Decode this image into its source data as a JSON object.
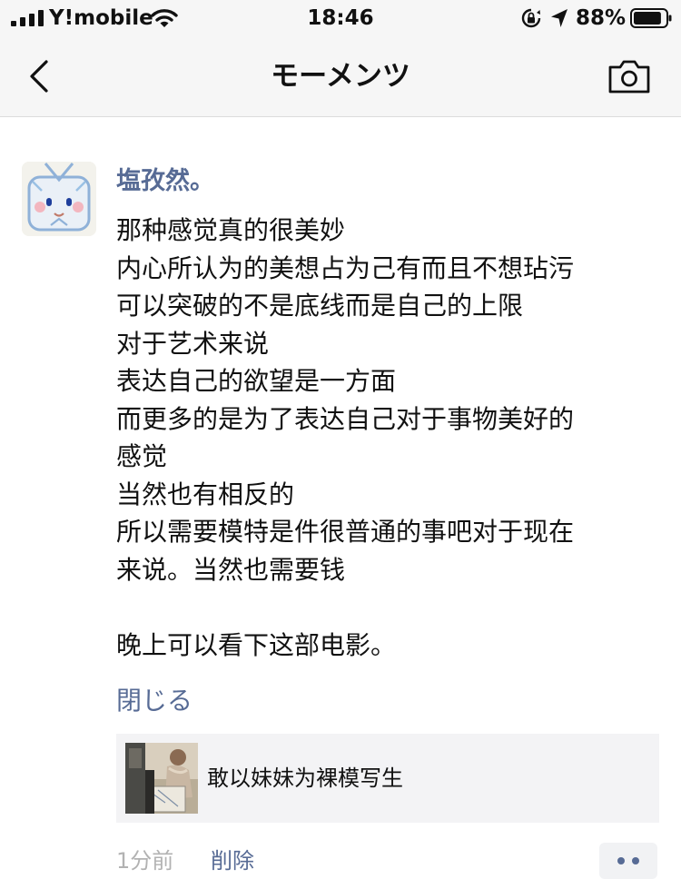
{
  "status_bar": {
    "carrier": "Y!mobile",
    "time": "18:46",
    "battery_percent": "88%",
    "battery_level": 0.88,
    "icons": [
      "signal-icon",
      "wifi-icon",
      "orientation-lock-icon",
      "location-icon",
      "battery-icon"
    ]
  },
  "nav": {
    "title": "モーメンツ",
    "back_icon": "chevron-left-icon",
    "camera_icon": "camera-icon"
  },
  "post": {
    "author": "塩孜然。",
    "lines": [
      "那种感觉真的很美妙",
      "内心所认为的美想占为己有而且不想玷污",
      "可以突破的不是底线而是自己的上限",
      "对于艺术来说",
      "表达自己的欲望是一方面",
      "而更多的是为了表达自己对于事物美好的",
      "感觉",
      "当然也有相反的",
      "所以需要模特是件很普通的事吧对于现在",
      "来说。当然也需要钱",
      "",
      "晚上可以看下这部电影。"
    ],
    "collapse_label": "閉じる",
    "shared_link_title": "敢以妹妹为裸模写生",
    "time_ago": "1分前",
    "delete_label": "削除",
    "more_icon": "more-dots-icon"
  },
  "colors": {
    "link_blue": "#576b95",
    "muted_gray": "#b2b2b2",
    "nav_background": "#f6f6f6",
    "card_background": "#f3f3f5"
  }
}
